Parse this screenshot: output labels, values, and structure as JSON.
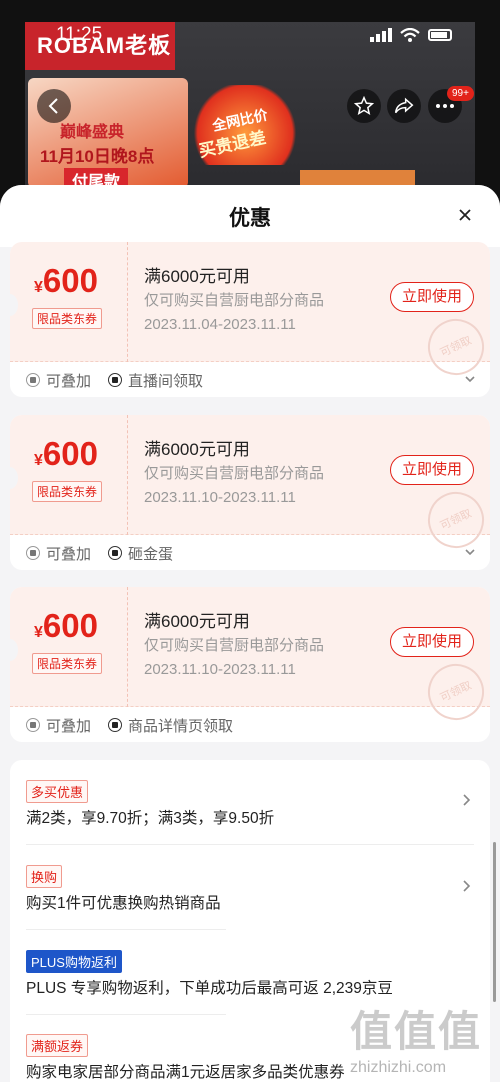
{
  "status_bar": {
    "time": "11:25"
  },
  "background": {
    "brand": "ROBAM老板",
    "promo_line1": "巅峰盛典",
    "promo_line2": "11月10日晚8点",
    "promo_line3": "付尾款",
    "fire_line1": "全网比价",
    "fire_line2": "买贵退差"
  },
  "nav": {
    "more_badge": "99+"
  },
  "sheet": {
    "title": "优惠"
  },
  "coupons": [
    {
      "currency": "¥",
      "amount": "600",
      "tag": "限品类东券",
      "title": "满6000元可用",
      "desc": "仅可购买自营厨电部分商品",
      "date": "2023.11.04-2023.11.11",
      "button": "立即使用",
      "stamp": "可领取",
      "footer_stack": "可叠加",
      "footer_source": "直播间领取"
    },
    {
      "currency": "¥",
      "amount": "600",
      "tag": "限品类东券",
      "title": "满6000元可用",
      "desc": "仅可购买自营厨电部分商品",
      "date": "2023.11.10-2023.11.11",
      "button": "立即使用",
      "stamp": "可领取",
      "footer_stack": "可叠加",
      "footer_source": "砸金蛋"
    },
    {
      "currency": "¥",
      "amount": "600",
      "tag": "限品类东券",
      "title": "满6000元可用",
      "desc": "仅可购买自营厨电部分商品",
      "date": "2023.11.10-2023.11.11",
      "button": "立即使用",
      "stamp": "可领取",
      "footer_stack": "可叠加",
      "footer_source": "商品详情页领取"
    }
  ],
  "promotions": [
    {
      "tag": "多买优惠",
      "text": "满2类，享9.70折；满3类，享9.50折"
    },
    {
      "tag": "换购",
      "text": "购买1件可优惠换购热销商品"
    },
    {
      "tag": "PLUS购物返利",
      "text": "PLUS 专享购物返利，下单成功后最高可返 2,239京豆"
    },
    {
      "tag": "满额返券",
      "text": "购家电家居部分商品满1元返居家多品类优惠券"
    }
  ],
  "watermark": {
    "logo": "值值值",
    "site": "zhizhizhi.com"
  }
}
